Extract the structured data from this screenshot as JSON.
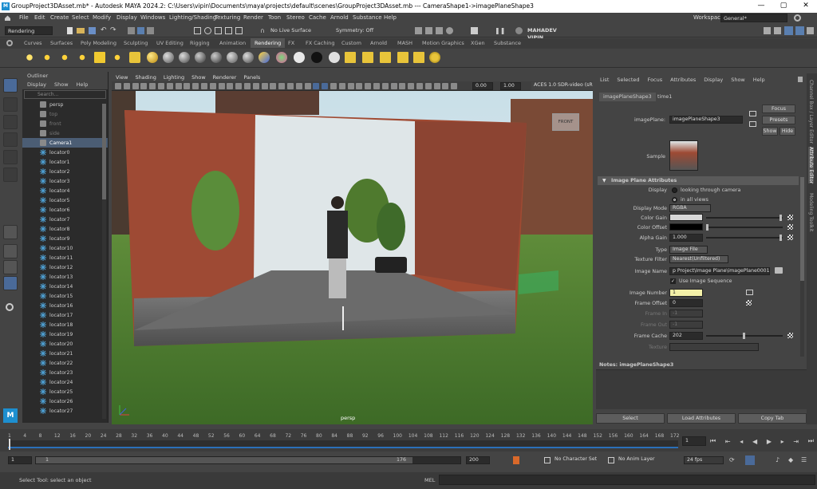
{
  "titlebar": {
    "app_badge": "M",
    "title": "GroupProject3DAsset.mb* - Autodesk MAYA 2024.2: C:\\Users\\vipin\\Documents\\maya\\projects\\default\\scenes\\GroupProject3DAsset.mb    ---    CameraShape1->imagePlaneShape3",
    "min": "—",
    "max": "▢",
    "close": "✕"
  },
  "menubar": {
    "items": [
      "File",
      "Edit",
      "Create",
      "Select",
      "Modify",
      "Display",
      "Windows",
      "Lighting/Shading",
      "Texturing",
      "Render",
      "Toon",
      "Stereo",
      "Cache",
      "Arnold",
      "Substance",
      "Help"
    ],
    "workspace_label": "Workspace:",
    "workspace_value": "General*"
  },
  "statusline": {
    "menuset": "Rendering",
    "live_surface": "No Live Surface",
    "symmetry": "Symmetry: Off",
    "user": "MAHADEV VIPIN"
  },
  "shelf_tabs": [
    "Curves",
    "Surfaces",
    "Poly Modeling",
    "Sculpting",
    "UV Editing",
    "Rigging",
    "Animation",
    "Rendering",
    "FX",
    "FX Caching",
    "Custom",
    "Arnold",
    "MASH",
    "Motion Graphics",
    "XGen",
    "Substance"
  ],
  "shelf_active": "Rendering",
  "outliner": {
    "title": "Outliner",
    "menu": [
      "Display",
      "Show",
      "Help"
    ],
    "search_placeholder": "Search...",
    "items": [
      {
        "name": "persp",
        "dim": false,
        "sel": false,
        "type": "cam"
      },
      {
        "name": "top",
        "dim": true,
        "sel": false,
        "type": "cam"
      },
      {
        "name": "front",
        "dim": true,
        "sel": false,
        "type": "cam"
      },
      {
        "name": "side",
        "dim": true,
        "sel": false,
        "type": "cam"
      },
      {
        "name": "Camera1",
        "dim": false,
        "sel": true,
        "type": "cam"
      },
      {
        "name": "locator0",
        "type": "loc"
      },
      {
        "name": "locator1",
        "type": "loc"
      },
      {
        "name": "locator2",
        "type": "loc"
      },
      {
        "name": "locator3",
        "type": "loc"
      },
      {
        "name": "locator4",
        "type": "loc"
      },
      {
        "name": "locator5",
        "type": "loc"
      },
      {
        "name": "locator6",
        "type": "loc"
      },
      {
        "name": "locator7",
        "type": "loc"
      },
      {
        "name": "locator8",
        "type": "loc"
      },
      {
        "name": "locator9",
        "type": "loc"
      },
      {
        "name": "locator10",
        "type": "loc"
      },
      {
        "name": "locator11",
        "type": "loc"
      },
      {
        "name": "locator12",
        "type": "loc"
      },
      {
        "name": "locator13",
        "type": "loc"
      },
      {
        "name": "locator14",
        "type": "loc"
      },
      {
        "name": "locator15",
        "type": "loc"
      },
      {
        "name": "locator16",
        "type": "loc"
      },
      {
        "name": "locator17",
        "type": "loc"
      },
      {
        "name": "locator18",
        "type": "loc"
      },
      {
        "name": "locator19",
        "type": "loc"
      },
      {
        "name": "locator20",
        "type": "loc"
      },
      {
        "name": "locator21",
        "type": "loc"
      },
      {
        "name": "locator22",
        "type": "loc"
      },
      {
        "name": "locator23",
        "type": "loc"
      },
      {
        "name": "locator24",
        "type": "loc"
      },
      {
        "name": "locator25",
        "type": "loc"
      },
      {
        "name": "locator26",
        "type": "loc"
      },
      {
        "name": "locator27",
        "type": "loc"
      }
    ]
  },
  "viewport": {
    "menu": [
      "View",
      "Shading",
      "Lighting",
      "Show",
      "Renderer",
      "Panels"
    ],
    "val1": "0.00",
    "val2": "1.00",
    "colorspace": "ACES 1.0 SDR-video (sRGB",
    "camera_label": "persp",
    "viewcube_label": "FRONT"
  },
  "attr": {
    "menu": [
      "List",
      "Selected",
      "Focus",
      "Attributes",
      "Display",
      "Show",
      "Help"
    ],
    "tabs": [
      "imagePlaneShape3",
      "time1"
    ],
    "imageplane_label": "imagePlane:",
    "imageplane_value": "imagePlaneShape3",
    "focus_btn": "Focus",
    "presets_btn": "Presets",
    "show_btn": "Show",
    "hide_btn": "Hide",
    "sample_label": "Sample",
    "section": "Image Plane Attributes",
    "display_label": "Display",
    "display_opt1": "looking through camera",
    "display_opt2": "in all views",
    "display_mode_label": "Display Mode",
    "display_mode_value": "RGBA",
    "color_gain_label": "Color Gain",
    "color_offset_label": "Color Offset",
    "alpha_gain_label": "Alpha Gain",
    "alpha_gain_value": "1.000",
    "type_label": "Type",
    "type_value": "Image File",
    "texfilter_label": "Texture Filter",
    "texfilter_value": "Nearest(Unfiltered)",
    "imgname_label": "Image Name",
    "imgname_value": "p Project\\Image Plane\\imagePlane0001.jpg",
    "use_seq_label": "Use Image Sequence",
    "imgnum_label": "Image Number",
    "imgnum_value": "1",
    "frameoffset_label": "Frame Offset",
    "frameoffset_value": "0",
    "framein_label": "Frame In",
    "framein_value": "-1",
    "frameout_label": "Frame Out",
    "frameout_value": "-1",
    "framecache_label": "Frame Cache",
    "framecache_value": "202",
    "texture_label": "Texture",
    "notes_label": "Notes:  imagePlaneShape3",
    "select_btn": "Select",
    "load_btn": "Load Attributes",
    "copy_btn": "Copy Tab"
  },
  "sidetabs": [
    "Channel Box / Layer Editor",
    "Attribute Editor",
    "Modeling Toolkit"
  ],
  "timeslider": {
    "ticks": [
      "1",
      "4",
      "8",
      "12",
      "16",
      "20",
      "24",
      "28",
      "32",
      "36",
      "40",
      "44",
      "48",
      "52",
      "56",
      "60",
      "64",
      "68",
      "72",
      "76",
      "80",
      "84",
      "88",
      "92",
      "96",
      "100",
      "104",
      "108",
      "112",
      "116",
      "120",
      "124",
      "128",
      "132",
      "136",
      "140",
      "144",
      "148",
      "152",
      "156",
      "160",
      "164",
      "168",
      "172"
    ],
    "current": "1"
  },
  "range": {
    "start": "1",
    "inner_start": "1",
    "inner_end": "176",
    "end": "200",
    "character_set": "No Character Set",
    "anim_layer": "No Anim Layer",
    "fps": "24 fps"
  },
  "helpline": {
    "message": "Select Tool: select an object",
    "mel": "MEL"
  }
}
